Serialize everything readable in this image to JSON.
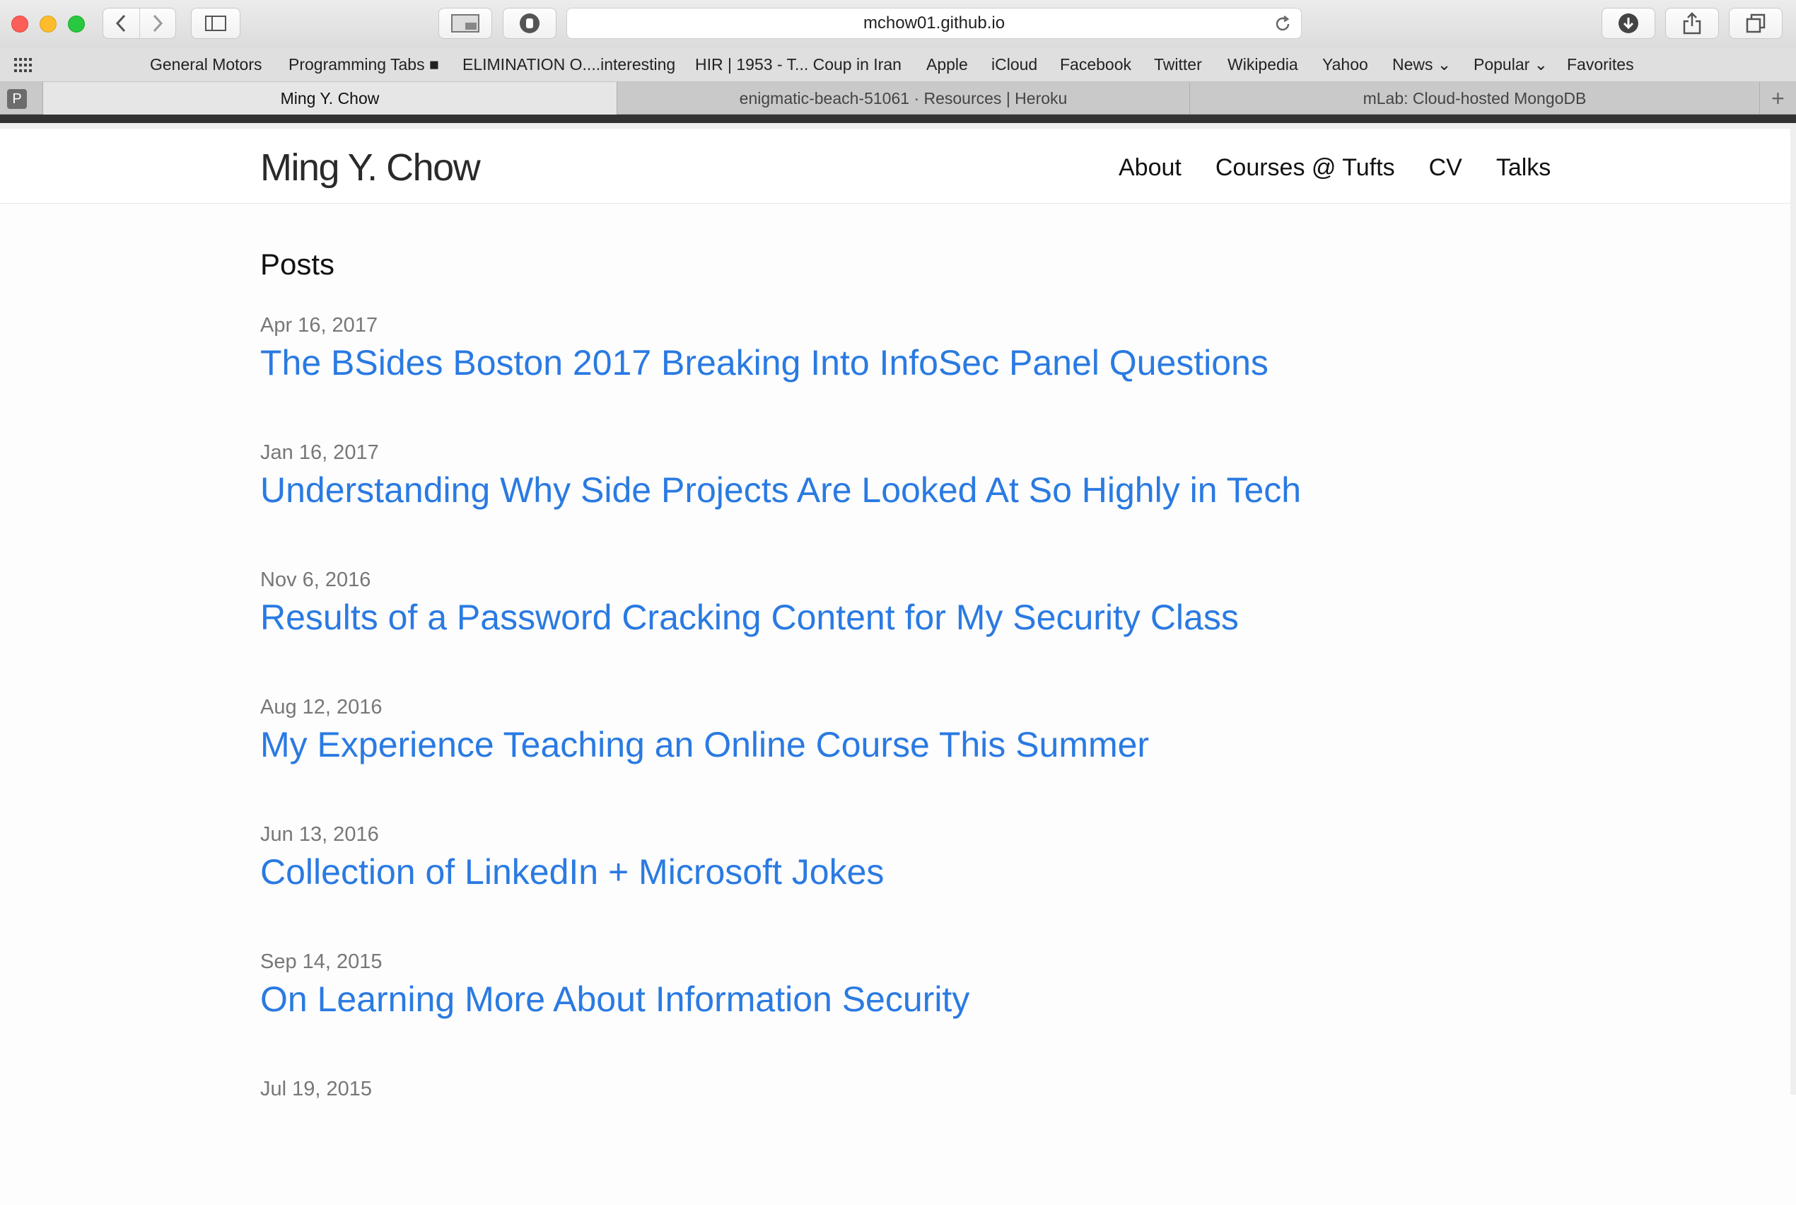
{
  "browser": {
    "url": "mchow01.github.io",
    "bookmarks": [
      "General Motors",
      "Programming Tabs ■",
      "ELIMINATION O....interesting",
      "HIR | 1953 - T... Coup in Iran",
      "Apple",
      "iCloud",
      "Facebook",
      "Twitter",
      "Wikipedia",
      "Yahoo",
      "News ⌄",
      "Popular ⌄",
      "Favorites"
    ],
    "pinned_tab_icon": "P",
    "tabs": [
      {
        "title": "Ming Y. Chow",
        "active": true
      },
      {
        "title": "enigmatic-beach-51061 · Resources | Heroku",
        "active": false
      },
      {
        "title": "mLab: Cloud-hosted MongoDB",
        "active": false
      }
    ],
    "new_tab_symbol": "+",
    "icons": [
      "back-icon",
      "forward-icon",
      "sidebar-icon",
      "share-screen-icon",
      "privacy-hand-icon",
      "reload-icon",
      "downloads-icon",
      "share-icon",
      "tabs-overview-icon",
      "grid-icon"
    ]
  },
  "site": {
    "title": "Ming Y. Chow",
    "nav": [
      "About",
      "Courses @ Tufts",
      "CV",
      "Talks"
    ],
    "posts_heading": "Posts",
    "posts": [
      {
        "date": "Apr 16, 2017",
        "title": "The BSides Boston 2017 Breaking Into InfoSec Panel Questions"
      },
      {
        "date": "Jan 16, 2017",
        "title": "Understanding Why Side Projects Are Looked At So Highly in Tech"
      },
      {
        "date": "Nov 6, 2016",
        "title": "Results of a Password Cracking Content for My Security Class"
      },
      {
        "date": "Aug 12, 2016",
        "title": "My Experience Teaching an Online Course This Summer"
      },
      {
        "date": "Jun 13, 2016",
        "title": "Collection of LinkedIn + Microsoft Jokes"
      },
      {
        "date": "Sep 14, 2015",
        "title": "On Learning More About Information Security"
      },
      {
        "date": "Jul 19, 2015",
        "title": ""
      }
    ],
    "colors": {
      "link": "#2a7ae2",
      "date": "#777777"
    }
  }
}
